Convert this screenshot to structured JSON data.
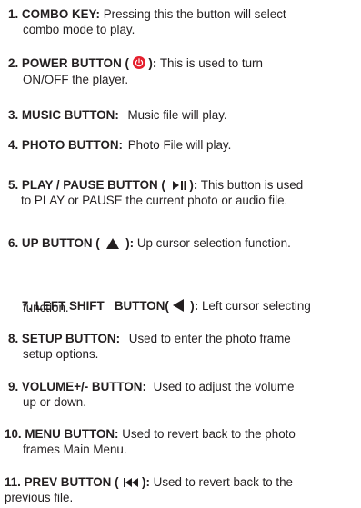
{
  "items": [
    {
      "num": "1.",
      "title": "COMBO KEY:",
      "text1": "Pressing this the button will select",
      "text2": "combo mode to play."
    },
    {
      "num": "2.",
      "title_pre": "POWER BUTTON (",
      "icon": "power-icon",
      "title_post": "):",
      "text1": "This is used to turn",
      "text2": "ON/OFF the player."
    },
    {
      "num": "3.",
      "title": "MUSIC BUTTON:",
      "text1": "Music file will play."
    },
    {
      "num": "4.",
      "title": "PHOTO BUTTON:",
      "text1": "Photo File will play."
    },
    {
      "num": "5.",
      "title_pre": "PLAY / PAUSE BUTTON (",
      "icon": "play-pause-icon",
      "title_post": "):",
      "text1": "This button is used",
      "text2": "to PLAY or PAUSE the current photo or audio file."
    },
    {
      "num": "6.",
      "title_pre": "UP BUTTON (",
      "icon": "up-triangle-icon",
      "title_post": "):",
      "text1": "Up cursor selection function."
    },
    {
      "num": "7.",
      "title_pre": "LEFT SHIFT   BUTTON(",
      "icon": "left-triangle-icon",
      "title_post": "):",
      "text1": "Left cursor selecting",
      "text2": "function."
    },
    {
      "num": "8.",
      "title": "SETUP BUTTON:",
      "text1": "Used to enter the photo frame",
      "text2": "setup options."
    },
    {
      "num": "9.",
      "title": "VOLUME+/- BUTTON:",
      "text1": "Used to adjust the volume",
      "text2": "up or down."
    },
    {
      "num": "10.",
      "title": "MENU BUTTON:",
      "text1": "Used to revert back to the photo",
      "text2": "frames Main Menu."
    },
    {
      "num": "11.",
      "title_pre": "PREV BUTTON (",
      "icon": "prev-icon",
      "title_post": "):",
      "text1": "Used to revert back to the",
      "text2": "previous file."
    }
  ]
}
